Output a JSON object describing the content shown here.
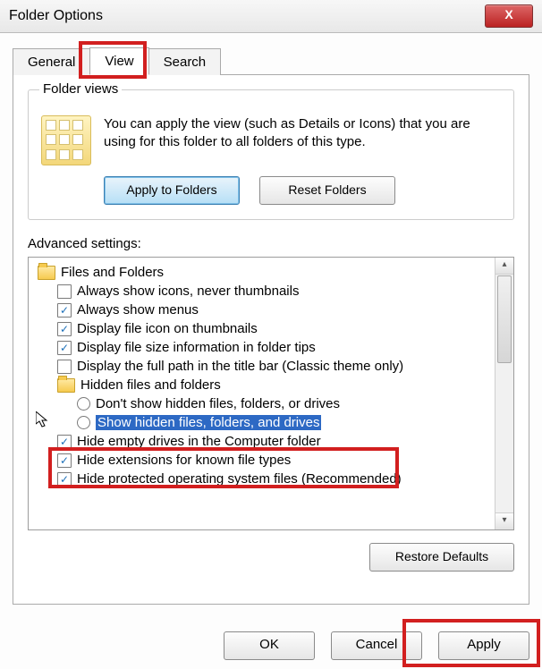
{
  "window": {
    "title": "Folder Options",
    "close_glyph": "X"
  },
  "tabs": {
    "general": "General",
    "view": "View",
    "search": "Search"
  },
  "folder_views": {
    "legend": "Folder views",
    "text": "You can apply the view (such as Details or Icons) that you are using for this folder to all folders of this type.",
    "apply_btn": "Apply to Folders",
    "reset_btn": "Reset Folders"
  },
  "advanced": {
    "label": "Advanced settings:",
    "root": "Files and Folders",
    "items": {
      "always_icons": "Always show icons, never thumbnails",
      "always_menus": "Always show menus",
      "display_file_icon": "Display file icon on thumbnails",
      "display_file_size": "Display file size information in folder tips",
      "display_full_path": "Display the full path in the title bar (Classic theme only)",
      "hidden_group": "Hidden files and folders",
      "hidden_dont": "Don't show hidden files, folders, or drives",
      "hidden_show": "Show hidden files, folders, and drives",
      "hide_empty": "Hide empty drives in the Computer folder",
      "hide_ext": "Hide extensions for known file types",
      "hide_os": "Hide protected operating system files (Recommended)"
    }
  },
  "restore_btn": "Restore Defaults",
  "dialog": {
    "ok": "OK",
    "cancel": "Cancel",
    "apply": "Apply"
  }
}
